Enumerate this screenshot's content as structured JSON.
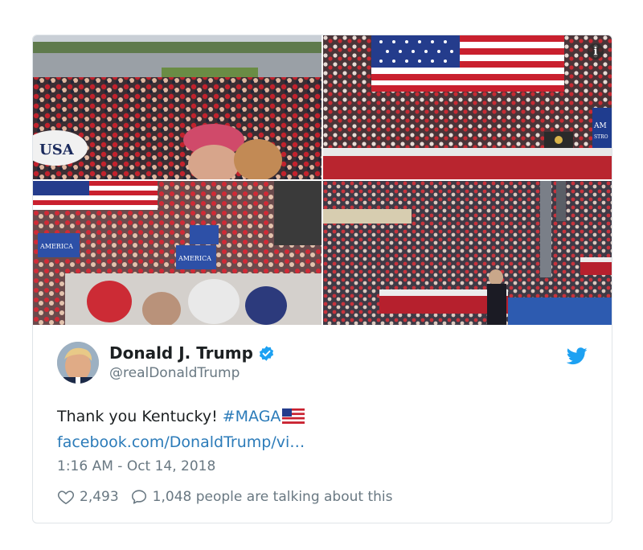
{
  "tweet": {
    "author_name": "Donald J. Trump",
    "author_handle": "@realDonaldTrump",
    "text": "Thank you Kentucky! ",
    "hashtag": "#MAGA",
    "link": "facebook.com/DonaldTrump/vi…",
    "timestamp": "1:16 AM - Oct 14, 2018",
    "likes": "2,493",
    "conversation": "1,048 people are talking about this"
  },
  "media": {
    "info_label": "i",
    "sign_usa": "USA",
    "sign_america_1": "AMERICA",
    "sign_america_2": "AMERICA",
    "sign_am": "AM",
    "sign_stro": "STRO"
  },
  "colors": {
    "link": "#2b7bb9",
    "text": "#1c2022",
    "muted": "#697882",
    "border": "#dfe4e8",
    "twitter_blue": "#1da1f2",
    "verified": "#1da1f2"
  },
  "icons": {
    "verified": "verified-badge-icon",
    "twitter": "twitter-bird-icon",
    "like": "heart-icon",
    "reply": "speech-bubble-icon",
    "info": "info-icon"
  }
}
